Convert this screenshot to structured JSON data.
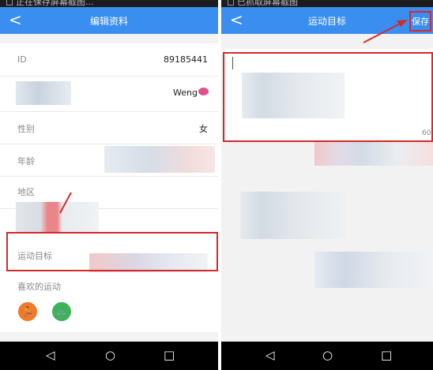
{
  "left": {
    "status_text": "正在保存屏幕截图...",
    "title": "编辑资料",
    "back_glyph": "<",
    "rows": {
      "id_label": "ID",
      "id_value": "89185441",
      "nickname_value": "Weng",
      "gender_label": "性别",
      "gender_value": "女",
      "age_label": "年龄",
      "region_label": "地区",
      "goal_label": "运动目标",
      "fav_label": "喜欢的运动"
    },
    "sports": [
      {
        "icon": "running-icon",
        "color": "#f07a2a"
      },
      {
        "icon": "bicycle-icon",
        "color": "#3cb35a"
      }
    ]
  },
  "right": {
    "status_text": "已抓取屏幕截图",
    "title": "运动目标",
    "back_glyph": "<",
    "save_label": "保存",
    "side_number": "60"
  },
  "nav": {
    "back": "◁",
    "home": "○",
    "recent": "□"
  },
  "colors": {
    "appbar": "#3a8ef0",
    "highlight": "#d42a2a",
    "lips": "#e0508a"
  }
}
